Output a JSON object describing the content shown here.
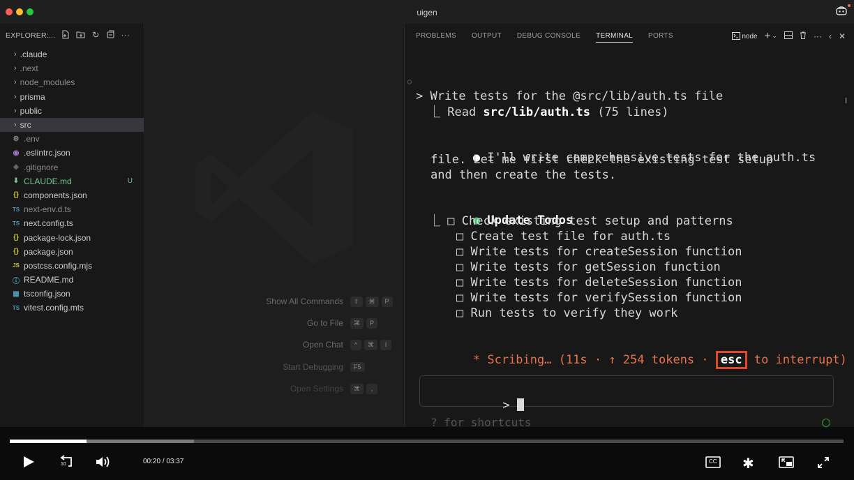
{
  "window": {
    "title": "uigen"
  },
  "sidebar": {
    "header": "EXPLORER:...",
    "items": [
      {
        "label": ".claude",
        "type": "folder"
      },
      {
        "label": ".next",
        "type": "folder"
      },
      {
        "label": "node_modules",
        "type": "folder"
      },
      {
        "label": "prisma",
        "type": "folder"
      },
      {
        "label": "public",
        "type": "folder"
      },
      {
        "label": "src",
        "type": "folder",
        "selected": true
      },
      {
        "label": ".env",
        "icon": "gear-icon"
      },
      {
        "label": ".eslintrc.json",
        "icon": "eslint-icon"
      },
      {
        "label": ".gitignore",
        "icon": "git-icon"
      },
      {
        "label": "CLAUDE.md",
        "icon": "markdown-icon",
        "badge": "U"
      },
      {
        "label": "components.json",
        "icon": "json-icon"
      },
      {
        "label": "next-env.d.ts",
        "icon": "ts-icon"
      },
      {
        "label": "next.config.ts",
        "icon": "ts-icon"
      },
      {
        "label": "package-lock.json",
        "icon": "json-icon"
      },
      {
        "label": "package.json",
        "icon": "json-icon"
      },
      {
        "label": "postcss.config.mjs",
        "icon": "js-icon"
      },
      {
        "label": "README.md",
        "icon": "info-icon"
      },
      {
        "label": "tsconfig.json",
        "icon": "tsconfig-icon"
      },
      {
        "label": "vitest.config.mts",
        "icon": "ts-icon"
      }
    ]
  },
  "editor": {
    "commands": [
      {
        "label": "Show All Commands",
        "keys": [
          "⇧",
          "⌘",
          "P"
        ]
      },
      {
        "label": "Go to File",
        "keys": [
          "⌘",
          "P"
        ]
      },
      {
        "label": "Open Chat",
        "keys": [
          "^",
          "⌘",
          "I"
        ]
      },
      {
        "label": "Start Debugging",
        "keys": [
          "F5"
        ]
      },
      {
        "label": "Open Settings",
        "keys": [
          "⌘",
          ","
        ]
      }
    ]
  },
  "panel": {
    "tabs": [
      "PROBLEMS",
      "OUTPUT",
      "DEBUG CONSOLE",
      "TERMINAL",
      "PORTS"
    ],
    "active_tab": "TERMINAL",
    "terminal_name": "node"
  },
  "terminal": {
    "prompt_line": "> Write tests for the @src/lib/auth.ts file",
    "read_prefix": "⎿ Read ",
    "read_file": "src/lib/auth.ts",
    "read_suffix": " (75 lines)",
    "message_lines": [
      "I'll write comprehensive tests for the auth.ts",
      "file. Let me first check the existing test setup",
      "and then create the tests."
    ],
    "todos_title": "Update Todos",
    "todos": [
      "Check existing test setup and patterns",
      "Create test file for auth.ts",
      "Write tests for createSession function",
      "Write tests for getSession function",
      "Write tests for deleteSession function",
      "Write tests for verifySession function",
      "Run tests to verify they work"
    ],
    "status_prefix": "* Scribing… (11s · ↑ 254 tokens · ",
    "status_key": "esc",
    "status_suffix": " to interrupt)",
    "input_prompt": ">",
    "hint": "? for shortcuts"
  },
  "player": {
    "current_time": "00:20",
    "duration": "03:37",
    "time_separator": "/",
    "progress": 0.092,
    "buffered": 0.221,
    "icons": [
      "play-icon",
      "rewind-10-icon",
      "volume-icon",
      "captions-icon",
      "settings-icon",
      "pip-icon",
      "fullscreen-icon"
    ],
    "rewind_label": "10",
    "cc_label": "CC"
  },
  "colors": {
    "accent_orange": "#e8734a",
    "highlight_box": "#e0482a",
    "todo_dot": "#4ec272",
    "untracked": "#73c991"
  }
}
